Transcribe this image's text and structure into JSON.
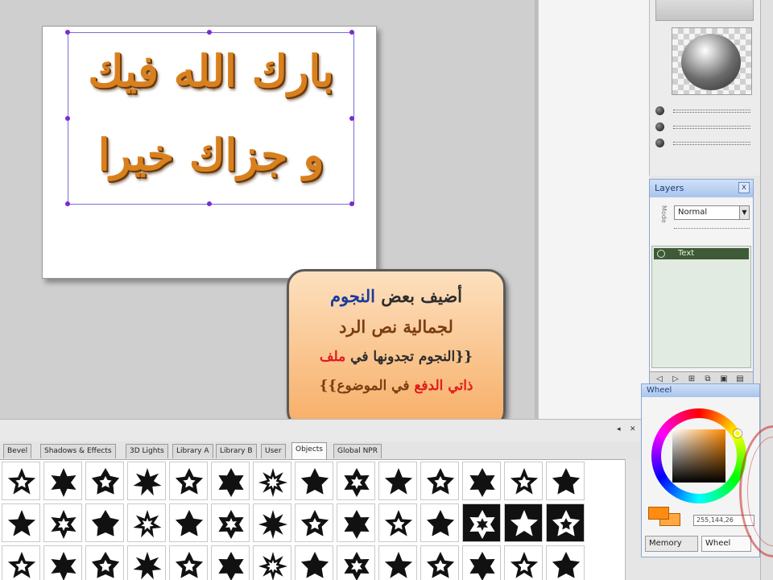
{
  "canvas": {
    "line1": "بارك الله فيك",
    "line2": "و جزاك خيرا"
  },
  "callout": {
    "line1_prefix": "أضيف بعض ",
    "line1_highlight": "النجوم",
    "line2": "لجمالية نص الرد",
    "line3_prefix": "{{النجوم تجدونها في ",
    "line3_highlight": "ملف",
    "line4_highlight": "ذاتي الدفع",
    "line4_suffix": " في الموضوع}}"
  },
  "layers_panel": {
    "title": "Layers",
    "close": "x",
    "blend_mode": "Normal",
    "blend_label": "Mode",
    "layer_name": "Text"
  },
  "wheel_panel": {
    "title": "Wheel",
    "rgb_value": "255,144,26",
    "tabs": [
      "Memory",
      "Wheel"
    ],
    "accent_color": "#ff8c10"
  },
  "library": {
    "tabs": [
      "Bevel",
      "Shadows & Effects",
      "3D Lights",
      "Library A",
      "Library B",
      "User",
      "Objects",
      "Global NPR"
    ],
    "active_tab": "Objects",
    "panel_controls": [
      "pin",
      "close"
    ]
  },
  "colors": {
    "canvas_text": "#d9801e",
    "callout_highlight_blue": "#1a3a9c",
    "callout_highlight_red": "#e21b1b",
    "selection_handle": "#7b2bd0"
  }
}
